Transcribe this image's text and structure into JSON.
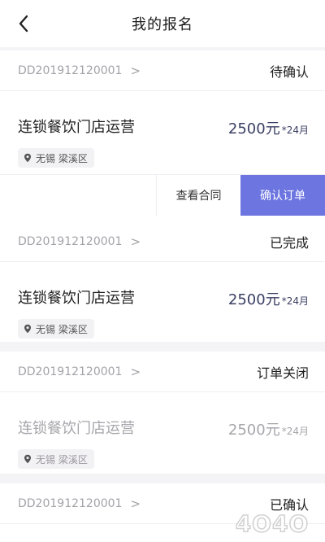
{
  "header": {
    "title": "我的报名",
    "back_icon": "chevron-left-icon"
  },
  "orders": [
    {
      "order_id": "DD201912120001",
      "order_chevron": ">",
      "status": "待确认",
      "job_title": "连锁餐饮门店运营",
      "price": "2500元",
      "price_unit": "*24月",
      "location": "无锡 梁溪区",
      "actions": [
        "查看合同",
        "确认订单"
      ]
    },
    {
      "order_id": "DD201912120001",
      "order_chevron": ">",
      "status": "已完成",
      "job_title": "连锁餐饮门店运营",
      "price": "2500元",
      "price_unit": "*24月",
      "location": "无锡 梁溪区"
    },
    {
      "order_id": "DD201912120001",
      "order_chevron": ">",
      "status": "订单关闭",
      "job_title": "连锁餐饮门店运营",
      "price": "2500元",
      "price_unit": "*24月",
      "location": "无锡 梁溪区"
    },
    {
      "order_id": "DD201912120001",
      "order_chevron": ">",
      "status": "已确认"
    }
  ],
  "colors": {
    "primary": "#6c75e0",
    "price": "#3a3f63",
    "muted": "#a4a2a8",
    "background": "#f4f3f6"
  },
  "watermark": "4O4O"
}
